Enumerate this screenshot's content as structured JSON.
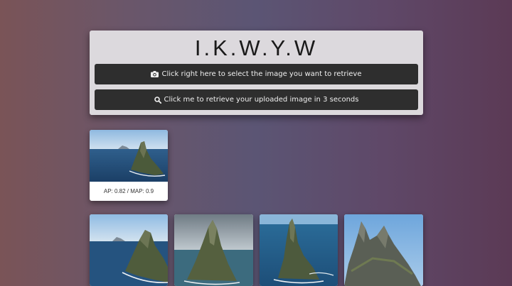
{
  "app": {
    "title": "I.K.W.Y.W"
  },
  "buttons": {
    "select_label": "Click right here to select the image you want to retrieve",
    "retrieve_label": "Click me to retrieve your uploaded image in 3 seconds"
  },
  "result": {
    "caption": "AP: 0.82 / MAP: 0.9"
  },
  "icons": {
    "select": "camera-icon",
    "retrieve": "search-icon"
  },
  "gallery": {
    "count_visible": 4
  }
}
